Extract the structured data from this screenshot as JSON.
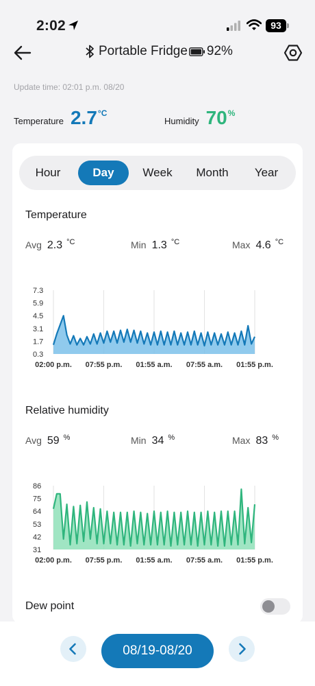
{
  "status_bar": {
    "time": "2:02",
    "battery": "93"
  },
  "header": {
    "device_name": "Portable Fridge",
    "device_battery": "92%"
  },
  "update_time": "Update time: 02:01 p.m. 08/20",
  "current": {
    "temperature_label": "Temperature",
    "temperature_value": "2.7",
    "temperature_unit": "°C",
    "humidity_label": "Humidity",
    "humidity_value": "70",
    "humidity_unit": "%"
  },
  "tabs": [
    {
      "label": "Hour",
      "active": false
    },
    {
      "label": "Day",
      "active": true
    },
    {
      "label": "Week",
      "active": false
    },
    {
      "label": "Month",
      "active": false
    },
    {
      "label": "Year",
      "active": false
    }
  ],
  "temperature_section": {
    "title": "Temperature",
    "avg_label": "Avg",
    "avg": "2.3",
    "avg_unit": "°C",
    "min_label": "Min",
    "min": "1.3",
    "min_unit": "°C",
    "max_label": "Max",
    "max": "4.6",
    "max_unit": "°C"
  },
  "humidity_section": {
    "title": "Relative humidity",
    "avg_label": "Avg",
    "avg": "59",
    "avg_unit": "%",
    "min_label": "Min",
    "min": "34",
    "min_unit": "%",
    "max_label": "Max",
    "max": "83",
    "max_unit": "%"
  },
  "dew_point": {
    "label": "Dew point",
    "enabled": false
  },
  "date_range": "08/19-08/20",
  "colors": {
    "accent": "#1479b8",
    "temp_fill": "#7cc1ea",
    "humidity_line": "#2fb57d",
    "humidity_fill": "#8fe0b9"
  },
  "icons": [
    "location-arrow-icon",
    "signal-icon",
    "wifi-icon",
    "back-arrow-icon",
    "bluetooth-icon",
    "battery-icon",
    "settings-icon",
    "chevron-left-icon",
    "chevron-right-icon"
  ],
  "chart_data": [
    {
      "type": "area",
      "ylabel": "",
      "xlabel": "",
      "y_ticks": [
        "7.3",
        "5.9",
        "4.5",
        "3.1",
        "1.7",
        "0.3"
      ],
      "ylim": [
        0.3,
        7.3
      ],
      "x_ticks": [
        "02:00 p.m.",
        "07:55 p.m.",
        "01:55 a.m.",
        "07:55 a.m.",
        "01:55 p.m."
      ],
      "x": [
        0,
        0.4,
        0.8,
        1.2,
        1.6,
        2.0,
        2.4,
        2.8,
        3.2,
        3.6,
        4.0,
        4.4,
        4.8,
        5.2,
        5.6,
        6.0,
        6.4,
        6.8,
        7.2,
        7.6,
        8.0,
        8.4,
        8.8,
        9.2,
        9.6,
        10.0,
        10.4,
        10.8,
        11.2,
        11.6,
        12.0,
        12.4,
        12.8,
        13.2,
        13.6,
        14.0,
        14.4,
        14.8,
        15.2,
        15.6,
        16.0,
        16.4,
        16.8,
        17.2,
        17.6,
        18.0,
        18.4,
        18.8,
        19.2,
        19.6,
        20.0,
        20.4,
        20.8,
        21.2,
        21.6,
        22.0,
        22.4,
        22.8,
        23.2,
        23.6,
        24.0
      ],
      "values": [
        1.3,
        2.5,
        3.5,
        4.5,
        2.4,
        1.4,
        2.3,
        1.3,
        2.0,
        1.3,
        2.2,
        1.4,
        2.5,
        1.4,
        2.6,
        1.5,
        2.8,
        1.6,
        2.8,
        1.5,
        2.9,
        1.6,
        3.0,
        1.6,
        2.9,
        1.5,
        2.8,
        1.4,
        2.6,
        1.3,
        2.7,
        1.3,
        2.8,
        1.3,
        2.7,
        1.3,
        2.8,
        1.3,
        2.6,
        1.3,
        2.7,
        1.3,
        2.8,
        1.3,
        2.6,
        1.2,
        2.7,
        1.3,
        2.6,
        1.3,
        2.5,
        1.3,
        2.7,
        1.3,
        2.6,
        1.3,
        2.8,
        1.3,
        3.4,
        1.4,
        2.2
      ]
    },
    {
      "type": "area",
      "ylabel": "",
      "xlabel": "",
      "y_ticks": [
        "86",
        "75",
        "64",
        "53",
        "42",
        "31"
      ],
      "ylim": [
        31,
        86
      ],
      "x_ticks": [
        "02:00 p.m.",
        "07:55 p.m.",
        "01:55 a.m.",
        "07:55 a.m.",
        "01:55 p.m."
      ],
      "x": [
        0,
        0.4,
        0.8,
        1.2,
        1.6,
        2.0,
        2.4,
        2.8,
        3.2,
        3.6,
        4.0,
        4.4,
        4.8,
        5.2,
        5.6,
        6.0,
        6.4,
        6.8,
        7.2,
        7.6,
        8.0,
        8.4,
        8.8,
        9.2,
        9.6,
        10.0,
        10.4,
        10.8,
        11.2,
        11.6,
        12.0,
        12.4,
        12.8,
        13.2,
        13.6,
        14.0,
        14.4,
        14.8,
        15.2,
        15.6,
        16.0,
        16.4,
        16.8,
        17.2,
        17.6,
        18.0,
        18.4,
        18.8,
        19.2,
        19.6,
        20.0,
        20.4,
        20.8,
        21.2,
        21.6,
        22.0,
        22.4,
        22.8,
        23.2,
        23.6,
        24.0
      ],
      "values": [
        66,
        79,
        79,
        40,
        70,
        35,
        68,
        36,
        69,
        38,
        72,
        40,
        67,
        36,
        66,
        36,
        64,
        36,
        63,
        35,
        63,
        35,
        63,
        34,
        64,
        36,
        63,
        35,
        62,
        35,
        64,
        35,
        63,
        35,
        64,
        34,
        63,
        35,
        63,
        35,
        64,
        35,
        63,
        34,
        63,
        35,
        64,
        35,
        63,
        34,
        64,
        34,
        64,
        35,
        64,
        35,
        83,
        36,
        67,
        37,
        70
      ]
    }
  ]
}
